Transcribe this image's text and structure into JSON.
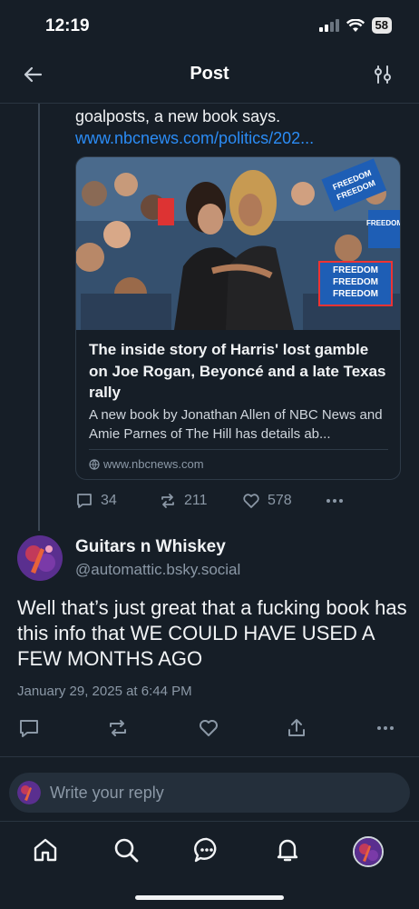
{
  "status_bar": {
    "time": "12:19",
    "battery": "58"
  },
  "header": {
    "title": "Post"
  },
  "parent_post": {
    "text_tail": "goalposts, a new book says.",
    "link_text": "www.nbcnews.com/politics/202...",
    "card": {
      "image_signs": [
        "FREEDOM",
        "FREEDOM",
        "FREEDOM",
        "FREEDOM",
        "FREEDOM",
        "FREEDOM"
      ],
      "title": "The inside story of Harris' lost gamble on Joe Rogan, Beyoncé and a late Texas rally",
      "description": "A new book by Jonathan Allen of NBC News and Amie Parnes of The Hill has details ab...",
      "domain": "www.nbcnews.com"
    },
    "stats": {
      "replies": "34",
      "reposts": "211",
      "likes": "578"
    }
  },
  "main_post": {
    "author_name": "Guitars n Whiskey",
    "author_handle": "@automattic.bsky.social",
    "text": "Well that’s just great that a fucking book has this info that WE COULD HAVE USED A FEW MONTHS AGO",
    "date": "January 29, 2025 at 6:44 PM"
  },
  "composer": {
    "placeholder": "Write your reply"
  },
  "colors": {
    "background": "#161e27",
    "link": "#2b8cf5",
    "muted": "#8b98a6",
    "accent_sign": "#1e5eb5"
  },
  "icons": [
    "back-arrow-icon",
    "filter-sliders-icon",
    "reply-icon",
    "repost-icon",
    "heart-icon",
    "more-icon",
    "share-icon",
    "home-icon",
    "search-icon",
    "chat-icon",
    "bell-icon",
    "globe-icon"
  ]
}
